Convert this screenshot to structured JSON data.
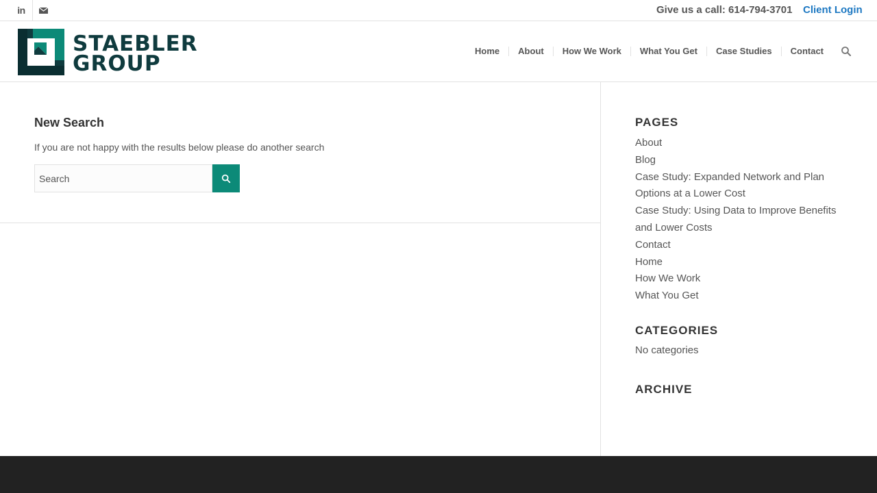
{
  "topbar": {
    "social": [
      {
        "icon": "linkedin-icon",
        "glyph": "in"
      },
      {
        "icon": "mail-icon"
      }
    ],
    "phone": "Give us a call: 614-794-3701",
    "client_login": "Client Login"
  },
  "header": {
    "logo_line1": "STAEBLER",
    "logo_line2": "GROUP",
    "nav": [
      "Home",
      "About",
      "How We Work",
      "What You Get",
      "Case Studies",
      "Contact"
    ],
    "search_icon": "search-icon"
  },
  "main": {
    "title": "New Search",
    "description": "If you are not happy with the results below please do another search",
    "search_placeholder": "Search",
    "search_button_icon": "search-icon"
  },
  "sidebar": {
    "pages_title": "PAGES",
    "pages": [
      "About",
      "Blog",
      "Case Study: Expanded Network and Plan Options at a Lower Cost",
      "Case Study: Using Data to Improve Benefits and Lower Costs",
      "Contact",
      "Home",
      "How We Work",
      "What You Get"
    ],
    "categories_title": "CATEGORIES",
    "no_categories": "No categories",
    "archive_title": "ARCHIVE"
  },
  "colors": {
    "accent": "#0c8a78",
    "link": "#1d78c2",
    "logo": "#0f3b3e",
    "footer": "#222222"
  }
}
